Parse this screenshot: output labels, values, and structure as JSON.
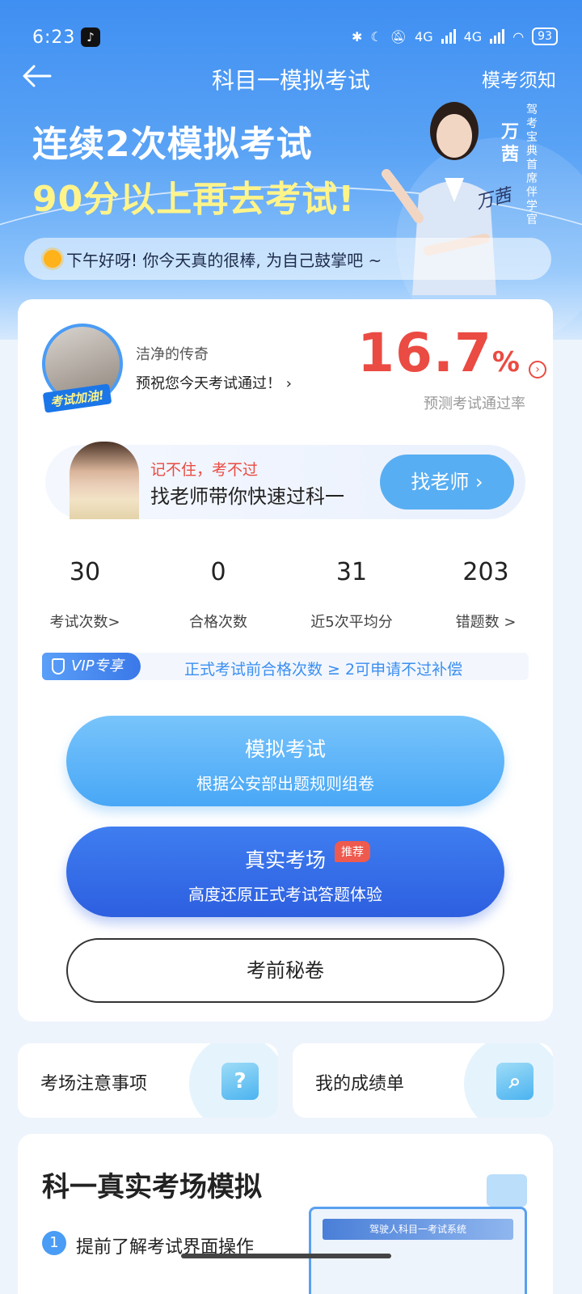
{
  "status_bar": {
    "time": "6:23",
    "network_a": "4G",
    "network_b": "4G",
    "battery": "93"
  },
  "nav": {
    "title": "科目一模拟考试",
    "notice_label": "模考须知"
  },
  "hero": {
    "headline_line1": "连续2次模拟考试",
    "headline_line2": "90分以上再去考试!",
    "coach_name": "万茜",
    "coach_title": "驾考宝典首席伴学官",
    "signature": "万茜",
    "greeting": "下午好呀! 你今天真的很棒, 为自己鼓掌吧 ~"
  },
  "profile": {
    "avatar_banner": "考试加油!",
    "username": "洁净的传奇",
    "wish": "预祝您今天考试通过！",
    "pass_rate": "16.7",
    "pass_rate_unit": "%",
    "pass_rate_label": "预测考试通过率"
  },
  "teacher_banner": {
    "line1": "记不住，考不过",
    "line2": "找老师带你快速过科一",
    "button": "找老师"
  },
  "stats": [
    {
      "value": "30",
      "label": "考试次数>"
    },
    {
      "value": "0",
      "label": "合格次数"
    },
    {
      "value": "31",
      "label": "近5次平均分"
    },
    {
      "value": "203",
      "label": "错题数 >"
    }
  ],
  "vip": {
    "tag": "VIP专享",
    "text": "正式考试前合格次数 ≥ 2可申请不过补偿"
  },
  "buttons": {
    "mock_title": "模拟考试",
    "mock_sub": "根据公安部出题规则组卷",
    "real_title": "真实考场",
    "real_badge": "推荐",
    "real_sub": "高度还原正式考试答题体验",
    "secret": "考前秘卷"
  },
  "quick_links": {
    "notes": "考场注意事项",
    "transcript": "我的成绩单"
  },
  "simulation": {
    "heading": "科一真实考场模拟",
    "step1_num": "1",
    "step1_text": "提前了解考试界面操作",
    "preview_title": "驾驶人科目一考试系统"
  },
  "colors": {
    "primary": "#4a9cf5",
    "accent_red": "#ea4b42",
    "deep_blue": "#2d5fe0",
    "headline_yellow": "#fff48a"
  }
}
